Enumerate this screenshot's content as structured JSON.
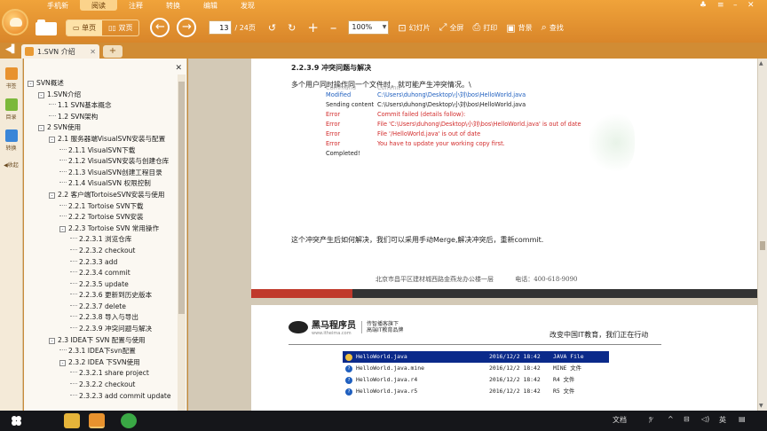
{
  "menu": {
    "tabs": [
      "手机新",
      "阅读",
      "注释",
      "转换",
      "编辑",
      "发现"
    ],
    "active_index": 1
  },
  "toolbar": {
    "single_page": "单页",
    "double_page": "双页",
    "page_current": "13",
    "page_total": "/ 24页",
    "zoom": "100%",
    "slideshow": "幻灯片",
    "fullscreen": "全屏",
    "print": "打印",
    "background": "背景",
    "find": "查找"
  },
  "tab": {
    "title": "1.SVN 介绍"
  },
  "leftbar": {
    "bookmark": "书签",
    "outline": "目录",
    "convert": "转换",
    "collapse": "收起"
  },
  "outline": [
    {
      "level": 0,
      "toggle": "-",
      "text": "SVN概述"
    },
    {
      "level": 1,
      "toggle": "-",
      "text": "1.SVN介绍"
    },
    {
      "level": 2,
      "toggle": "",
      "text": "1.1 SVN基本概念"
    },
    {
      "level": 2,
      "toggle": "",
      "text": "1.2 SVN架构"
    },
    {
      "level": 1,
      "toggle": "-",
      "text": "2 SVN使用"
    },
    {
      "level": 2,
      "toggle": "-",
      "text": "2.1 服务器端VisualSVN安装与配置"
    },
    {
      "level": 3,
      "toggle": "",
      "text": "2.1.1 VisualSVN下载"
    },
    {
      "level": 3,
      "toggle": "",
      "text": "2.1.2 VisualSVN安装与创建仓库"
    },
    {
      "level": 3,
      "toggle": "",
      "text": "2.1.3 VisualSVN创建工程目录"
    },
    {
      "level": 3,
      "toggle": "",
      "text": "2.1.4 VisualSVN 权限控制"
    },
    {
      "level": 2,
      "toggle": "-",
      "text": "2.2 客户端TortoiseSVN安装与使用"
    },
    {
      "level": 3,
      "toggle": "",
      "text": "2.2.1 Tortoise SVN下载"
    },
    {
      "level": 3,
      "toggle": "",
      "text": "2.2.2 Tortoise SVN安装"
    },
    {
      "level": 3,
      "toggle": "-",
      "text": "2.2.3 Tortoise SVN 常用操作"
    },
    {
      "level": 4,
      "toggle": "",
      "text": "2.2.3.1 浏览仓库"
    },
    {
      "level": 4,
      "toggle": "",
      "text": "2.2.3.2 checkout"
    },
    {
      "level": 4,
      "toggle": "",
      "text": "2.2.3.3 add"
    },
    {
      "level": 4,
      "toggle": "",
      "text": "2.2.3.4 commit"
    },
    {
      "level": 4,
      "toggle": "",
      "text": "2.2.3.5 update"
    },
    {
      "level": 4,
      "toggle": "",
      "text": "2.2.3.6 更新到历史版本"
    },
    {
      "level": 4,
      "toggle": "",
      "text": "2.2.3.7 delete"
    },
    {
      "level": 4,
      "toggle": "",
      "text": "2.2.3.8 导入与导出"
    },
    {
      "level": 4,
      "toggle": "",
      "text": "2.2.3.9 冲突问题与解决"
    },
    {
      "level": 2,
      "toggle": "-",
      "text": "2.3 IDEA下 SVN 配置与使用"
    },
    {
      "level": 3,
      "toggle": "",
      "text": "2.3.1 IDEA下svn配置"
    },
    {
      "level": 3,
      "toggle": "-",
      "text": "2.3.2 IDEA 下SVN使用"
    },
    {
      "level": 4,
      "toggle": "",
      "text": "2.3.2.1 share project"
    },
    {
      "level": 4,
      "toggle": "",
      "text": "2.3.2.2 checkout"
    },
    {
      "level": 4,
      "toggle": "",
      "text": "2.3.2.3 add commit update"
    }
  ],
  "doc": {
    "heading": "2.2.3.9 冲突问题与解决",
    "intro": "多个用户同时操作同一个文件时，就可能产生冲突情况。\\",
    "console_hidden": [
      "Command",
      "Commit"
    ],
    "console": [
      {
        "k": "Modified",
        "v": "C:\\Users\\duhong\\Desktop\\小刘\\bos\\HelloWorld.java",
        "c": "blue"
      },
      {
        "k": "Sending content",
        "v": "C:\\Users\\duhong\\Desktop\\小刘\\bos\\HelloWorld.java",
        "c": "black"
      },
      {
        "k": "Error",
        "v": "Commit failed (details follow):",
        "c": "red"
      },
      {
        "k": "Error",
        "v": "File 'C:\\Users\\duhong\\Desktop\\小刘\\bos\\HelloWorld.java' is out of date",
        "c": "red"
      },
      {
        "k": "Error",
        "v": "File '/HelloWorld.java' is out of date",
        "c": "red"
      },
      {
        "k": "Error",
        "v": "You have to update your working copy first.",
        "c": "red"
      },
      {
        "k": "Completed!",
        "v": "",
        "c": "black"
      }
    ],
    "conclusion": "这个冲突产生后如何解决，我们可以采用手动Merge,解决冲突后，重新commit.",
    "footer_address": "北京市昌平区建材城西路金燕龙办公楼一层",
    "footer_phone": "电话：400-618-9090",
    "brand_name": "黑马程序员",
    "brand_url": "www.itheima.com",
    "brand_tag_1": "传智播客旗下",
    "brand_tag_2": "高端IT教育品牌",
    "slogan": "改变中国IT教育，我们正在行动",
    "files": [
      {
        "name": "HelloWorld.java",
        "date": "2016/12/2 18:42",
        "type": "JAVA File",
        "selected": true
      },
      {
        "name": "HelloWorld.java.mine",
        "date": "2016/12/2 18:42",
        "type": "MINE 文件",
        "selected": false
      },
      {
        "name": "HelloWorld.java.r4",
        "date": "2016/12/2 18:42",
        "type": "R4 文件",
        "selected": false
      },
      {
        "name": "HelloWorld.java.r5",
        "date": "2016/12/2 18:42",
        "type": "R5 文件",
        "selected": false
      }
    ]
  },
  "taskbar": {
    "ime": "文档",
    "lang": "英"
  },
  "colors": {
    "accent": "#e8922e",
    "selection": "#0b2a8a",
    "error": "#d22b2b",
    "link": "#1f5fbf"
  }
}
